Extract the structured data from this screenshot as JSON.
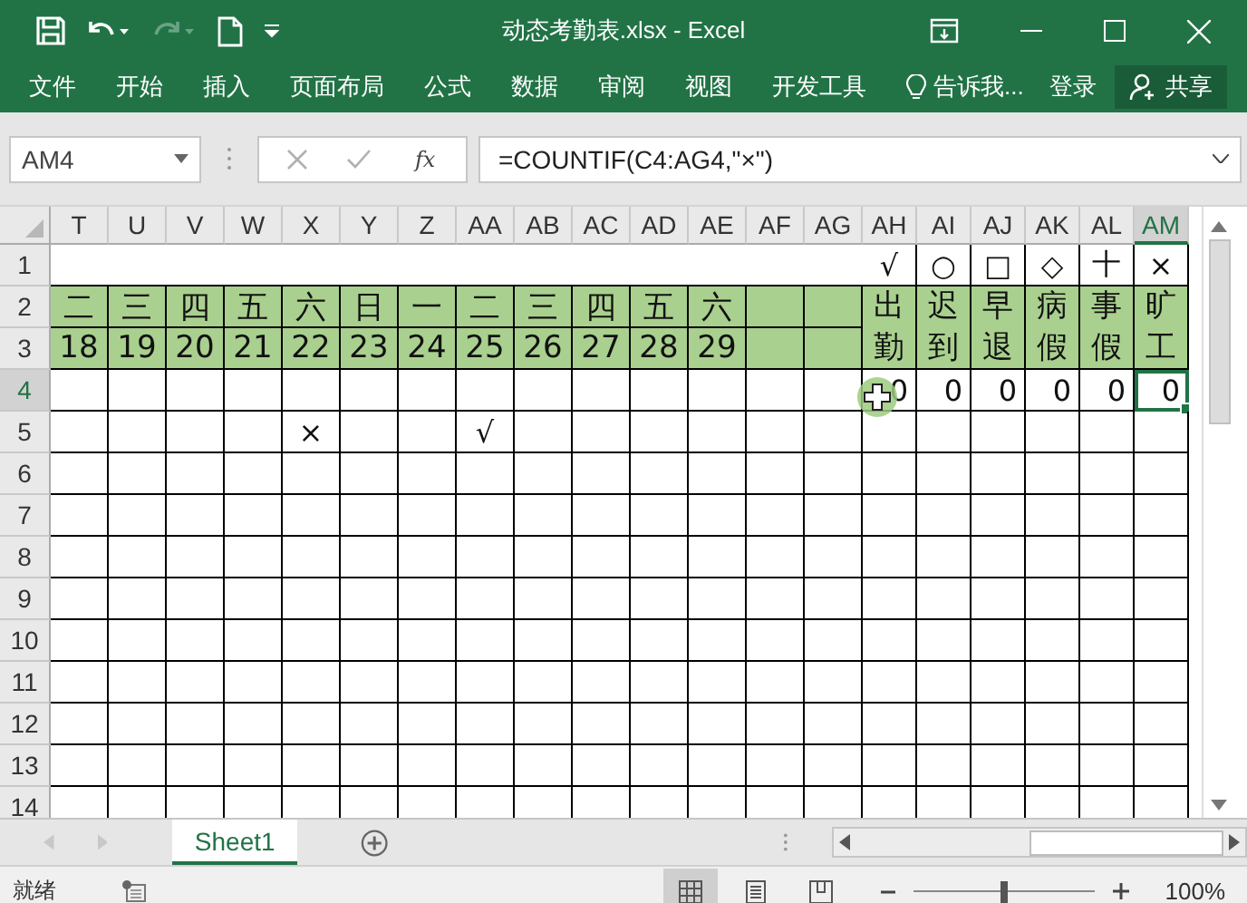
{
  "title_bar": {
    "title": "动态考勤表.xlsx - Excel"
  },
  "ribbon": {
    "tabs": [
      "文件",
      "开始",
      "插入",
      "页面布局",
      "公式",
      "数据",
      "审阅",
      "视图",
      "开发工具"
    ],
    "tell_me": "告诉我...",
    "sign_in": "登录",
    "share": "共享"
  },
  "formula_bar": {
    "name_box": "AM4",
    "function_label": "fx",
    "formula": "=COUNTIF(C4:AG4,\"×\")"
  },
  "sheet": {
    "columns": [
      {
        "label": "T",
        "selected": false
      },
      {
        "label": "U",
        "selected": false
      },
      {
        "label": "V",
        "selected": false
      },
      {
        "label": "W",
        "selected": false
      },
      {
        "label": "X",
        "selected": false
      },
      {
        "label": "Y",
        "selected": false
      },
      {
        "label": "Z",
        "selected": false
      },
      {
        "label": "AA",
        "selected": false
      },
      {
        "label": "AB",
        "selected": false
      },
      {
        "label": "AC",
        "selected": false
      },
      {
        "label": "AD",
        "selected": false
      },
      {
        "label": "AE",
        "selected": false
      },
      {
        "label": "AF",
        "selected": false
      },
      {
        "label": "AG",
        "selected": false
      },
      {
        "label": "AH",
        "selected": false
      },
      {
        "label": "AI",
        "selected": false
      },
      {
        "label": "AJ",
        "selected": false
      },
      {
        "label": "AK",
        "selected": false
      },
      {
        "label": "AL",
        "selected": false
      },
      {
        "label": "AM",
        "selected": true
      }
    ],
    "rows": [
      {
        "number": "1",
        "selected": false,
        "cells": [
          {
            "kind": "open"
          },
          {
            "kind": "open"
          },
          {
            "kind": "open"
          },
          {
            "kind": "open"
          },
          {
            "kind": "open"
          },
          {
            "kind": "open"
          },
          {
            "kind": "open"
          },
          {
            "kind": "open"
          },
          {
            "kind": "open"
          },
          {
            "kind": "open"
          },
          {
            "kind": "open"
          },
          {
            "kind": "open"
          },
          {
            "kind": "open"
          },
          {
            "kind": "open"
          },
          {
            "kind": "plain",
            "text": "√"
          },
          {
            "kind": "plain",
            "text": "○"
          },
          {
            "kind": "plain",
            "text": "□"
          },
          {
            "kind": "plain",
            "text": "◇"
          },
          {
            "kind": "plain",
            "text": "十"
          },
          {
            "kind": "plain",
            "text": "×"
          }
        ]
      },
      {
        "number": "2",
        "selected": false,
        "cells": [
          {
            "kind": "green",
            "text": "二"
          },
          {
            "kind": "green",
            "text": "三"
          },
          {
            "kind": "green",
            "text": "四"
          },
          {
            "kind": "green",
            "text": "五"
          },
          {
            "kind": "green",
            "text": "六"
          },
          {
            "kind": "green",
            "text": "日"
          },
          {
            "kind": "green",
            "text": "一"
          },
          {
            "kind": "green",
            "text": "二"
          },
          {
            "kind": "green",
            "text": "三"
          },
          {
            "kind": "green",
            "text": "四"
          },
          {
            "kind": "green",
            "text": "五"
          },
          {
            "kind": "green",
            "text": "六"
          },
          {
            "kind": "green"
          },
          {
            "kind": "green"
          },
          {
            "kind": "green_tall",
            "text": "出勤"
          },
          {
            "kind": "green_tall",
            "text": "迟到"
          },
          {
            "kind": "green_tall",
            "text": "早退"
          },
          {
            "kind": "green_tall",
            "text": "病假"
          },
          {
            "kind": "green_tall",
            "text": "事假"
          },
          {
            "kind": "green_tall",
            "text": "旷工"
          }
        ]
      },
      {
        "number": "3",
        "selected": false,
        "cells": [
          {
            "kind": "green",
            "text": "18"
          },
          {
            "kind": "green",
            "text": "19"
          },
          {
            "kind": "green",
            "text": "20"
          },
          {
            "kind": "green",
            "text": "21"
          },
          {
            "kind": "green",
            "text": "22"
          },
          {
            "kind": "green",
            "text": "23"
          },
          {
            "kind": "green",
            "text": "24"
          },
          {
            "kind": "green",
            "text": "25"
          },
          {
            "kind": "green",
            "text": "26"
          },
          {
            "kind": "green",
            "text": "27"
          },
          {
            "kind": "green",
            "text": "28"
          },
          {
            "kind": "green",
            "text": "29"
          },
          {
            "kind": "green"
          },
          {
            "kind": "green"
          }
        ]
      },
      {
        "number": "4",
        "selected": true,
        "cells": [
          {
            "kind": "plain",
            "selected": false
          },
          {
            "kind": "plain",
            "selected": false
          },
          {
            "kind": "plain",
            "selected": false
          },
          {
            "kind": "plain",
            "selected": false
          },
          {
            "kind": "plain",
            "selected": false
          },
          {
            "kind": "plain",
            "selected": false
          },
          {
            "kind": "plain",
            "selected": false
          },
          {
            "kind": "plain",
            "selected": false
          },
          {
            "kind": "plain",
            "selected": false
          },
          {
            "kind": "plain",
            "selected": false
          },
          {
            "kind": "plain",
            "selected": false
          },
          {
            "kind": "plain",
            "selected": false
          },
          {
            "kind": "plain",
            "selected": false
          },
          {
            "kind": "plain",
            "selected": false
          },
          {
            "kind": "number",
            "text": "0",
            "selected": false
          },
          {
            "kind": "number",
            "text": "0",
            "selected": false
          },
          {
            "kind": "number",
            "text": "0",
            "selected": false
          },
          {
            "kind": "number",
            "text": "0",
            "selected": false
          },
          {
            "kind": "number",
            "text": "0",
            "selected": false
          },
          {
            "kind": "number",
            "text": "0",
            "selected": true
          }
        ]
      },
      {
        "number": "5",
        "selected": false,
        "cells": [
          {
            "kind": "plain"
          },
          {
            "kind": "plain"
          },
          {
            "kind": "plain"
          },
          {
            "kind": "plain"
          },
          {
            "kind": "plain",
            "text": "×"
          },
          {
            "kind": "plain"
          },
          {
            "kind": "plain"
          },
          {
            "kind": "plain",
            "text": "√"
          },
          {
            "kind": "plain"
          },
          {
            "kind": "plain"
          },
          {
            "kind": "plain"
          },
          {
            "kind": "plain"
          },
          {
            "kind": "plain"
          },
          {
            "kind": "plain"
          },
          {
            "kind": "plain"
          },
          {
            "kind": "plain"
          },
          {
            "kind": "plain"
          },
          {
            "kind": "plain"
          },
          {
            "kind": "plain"
          },
          {
            "kind": "plain"
          }
        ]
      },
      {
        "number": "6",
        "selected": false
      },
      {
        "number": "7",
        "selected": false
      },
      {
        "number": "8",
        "selected": false
      },
      {
        "number": "9",
        "selected": false
      },
      {
        "number": "10",
        "selected": false
      },
      {
        "number": "11",
        "selected": false
      },
      {
        "number": "12",
        "selected": false
      },
      {
        "number": "13",
        "selected": false
      },
      {
        "number": "14",
        "selected": false
      }
    ]
  },
  "sheet_tabs": [
    {
      "label": "Sheet1",
      "selected": true
    }
  ],
  "status_bar": {
    "status": "就绪",
    "view_modes": [
      {
        "selected": true
      },
      {
        "selected": false
      },
      {
        "selected": false
      }
    ],
    "zoom": {
      "level": 0.5,
      "reading": "100%"
    }
  }
}
